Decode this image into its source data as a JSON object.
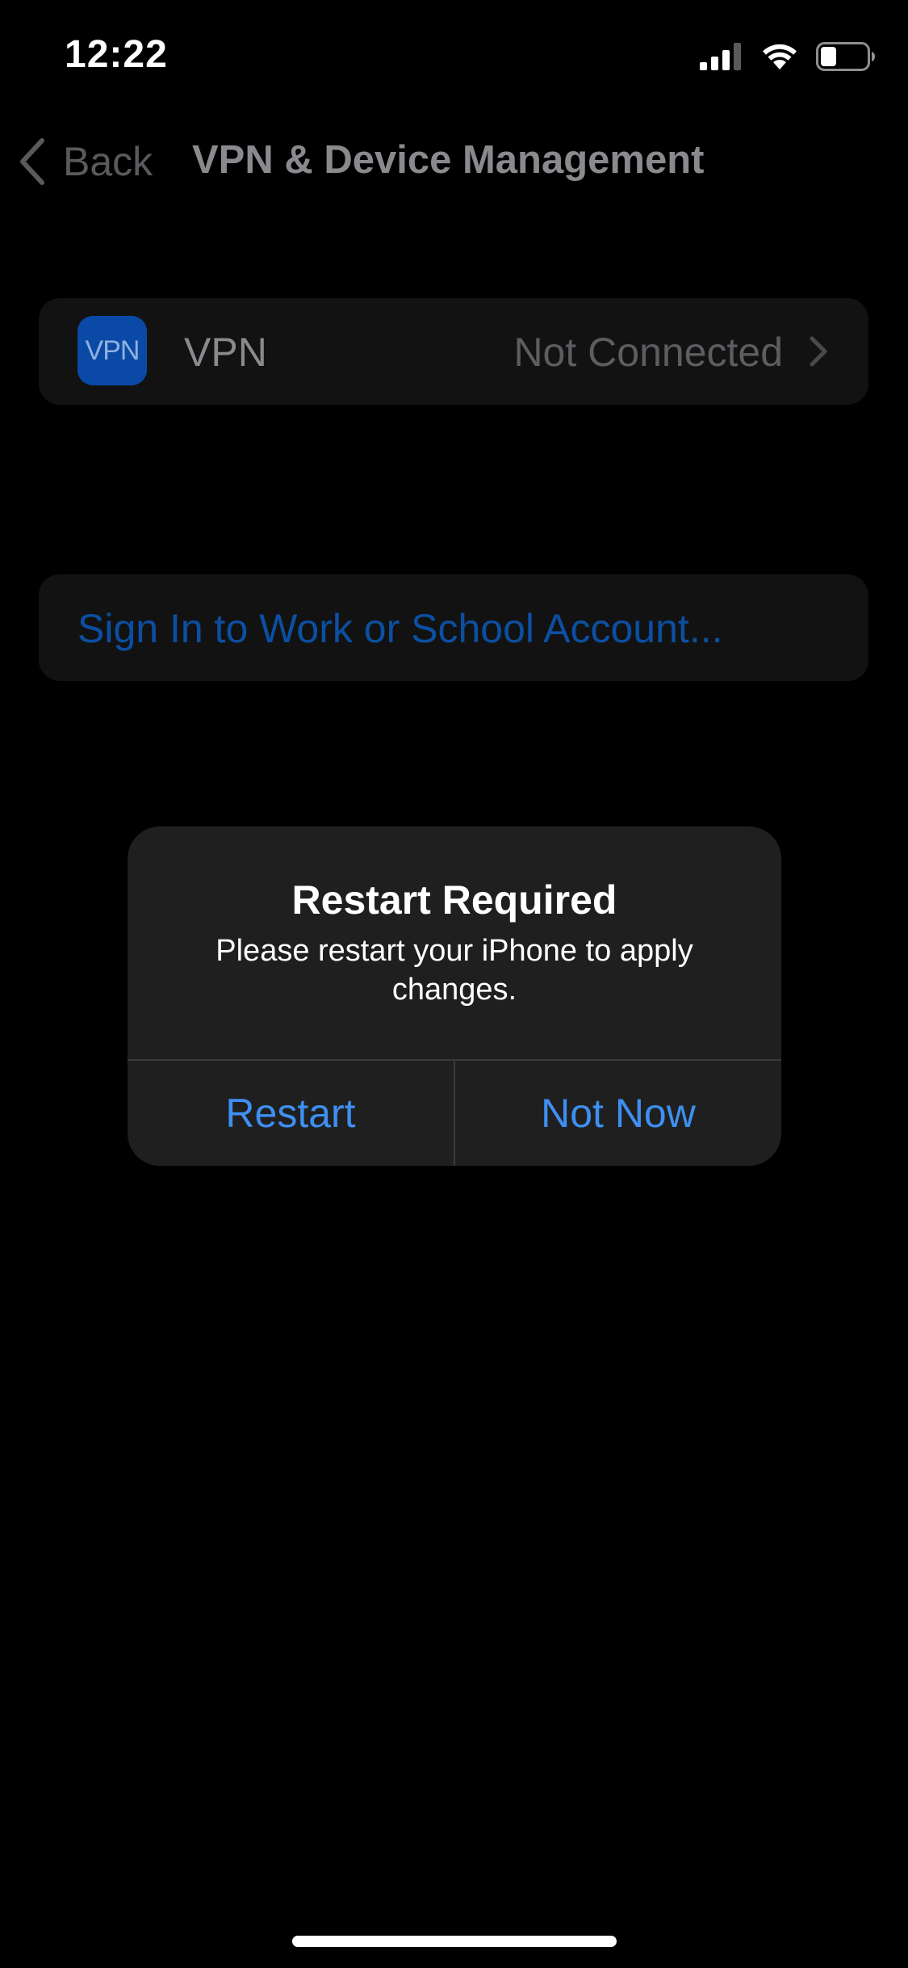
{
  "status_bar": {
    "time": "12:22",
    "signal_icon": "cellular-signal-icon",
    "wifi_icon": "wifi-icon",
    "battery_icon": "battery-icon",
    "battery_level": 0.35
  },
  "nav": {
    "back_label": "Back",
    "back_icon": "chevron-left-icon",
    "title": "VPN & Device Management"
  },
  "vpn_row": {
    "icon_text": "VPN",
    "label": "VPN",
    "status": "Not Connected",
    "chevron_icon": "chevron-right-icon"
  },
  "signin_row": {
    "label": "Sign In to Work or School Account..."
  },
  "alert": {
    "title": "Restart Required",
    "message": "Please restart your iPhone to apply changes.",
    "buttons": {
      "restart": "Restart",
      "not_now": "Not Now"
    }
  },
  "colors": {
    "background": "#000000",
    "accent": "#3e8ff0",
    "alert_background": "#1f1f20",
    "vpn_icon_background": "#0a4aa6"
  }
}
